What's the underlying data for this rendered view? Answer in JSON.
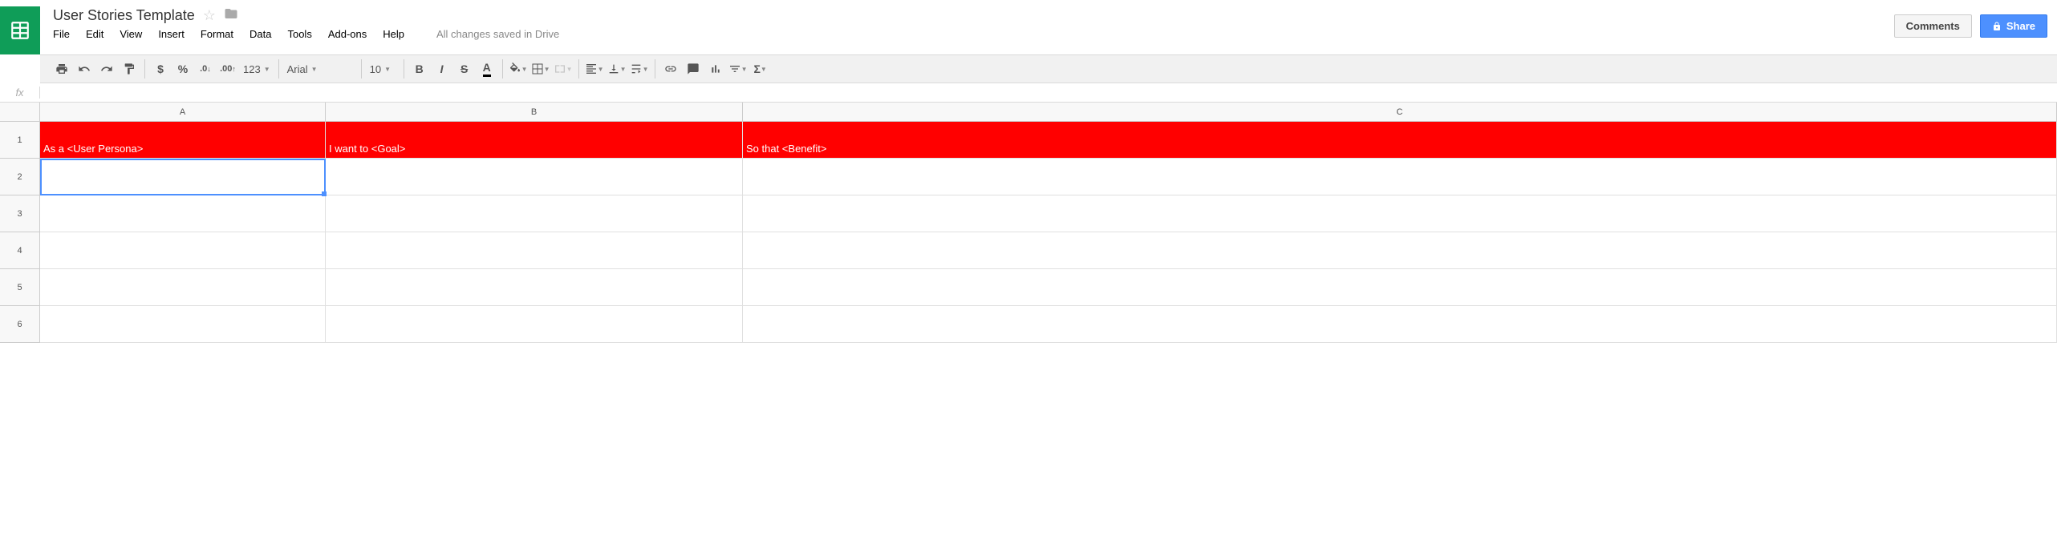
{
  "doc": {
    "title": "User Stories Template",
    "save_status": "All changes saved in Drive"
  },
  "menu": {
    "file": "File",
    "edit": "Edit",
    "view": "View",
    "insert": "Insert",
    "format": "Format",
    "data": "Data",
    "tools": "Tools",
    "addons": "Add-ons",
    "help": "Help"
  },
  "buttons": {
    "comments": "Comments",
    "share": "Share"
  },
  "toolbar": {
    "currency": "$",
    "percent": "%",
    "dec_decrease": ".0",
    "dec_increase": ".00",
    "more_formats": "123",
    "font": "Arial",
    "size": "10",
    "bold": "B",
    "italic": "I",
    "strike": "S",
    "textcolor": "A"
  },
  "formula": {
    "fx": "fx"
  },
  "columns": [
    "A",
    "B",
    "C"
  ],
  "rows": [
    "1",
    "2",
    "3",
    "4",
    "5",
    "6"
  ],
  "data": {
    "r1c1": "As a <User Persona>",
    "r1c2": "I want to <Goal>",
    "r1c3": "So that <Benefit>"
  }
}
